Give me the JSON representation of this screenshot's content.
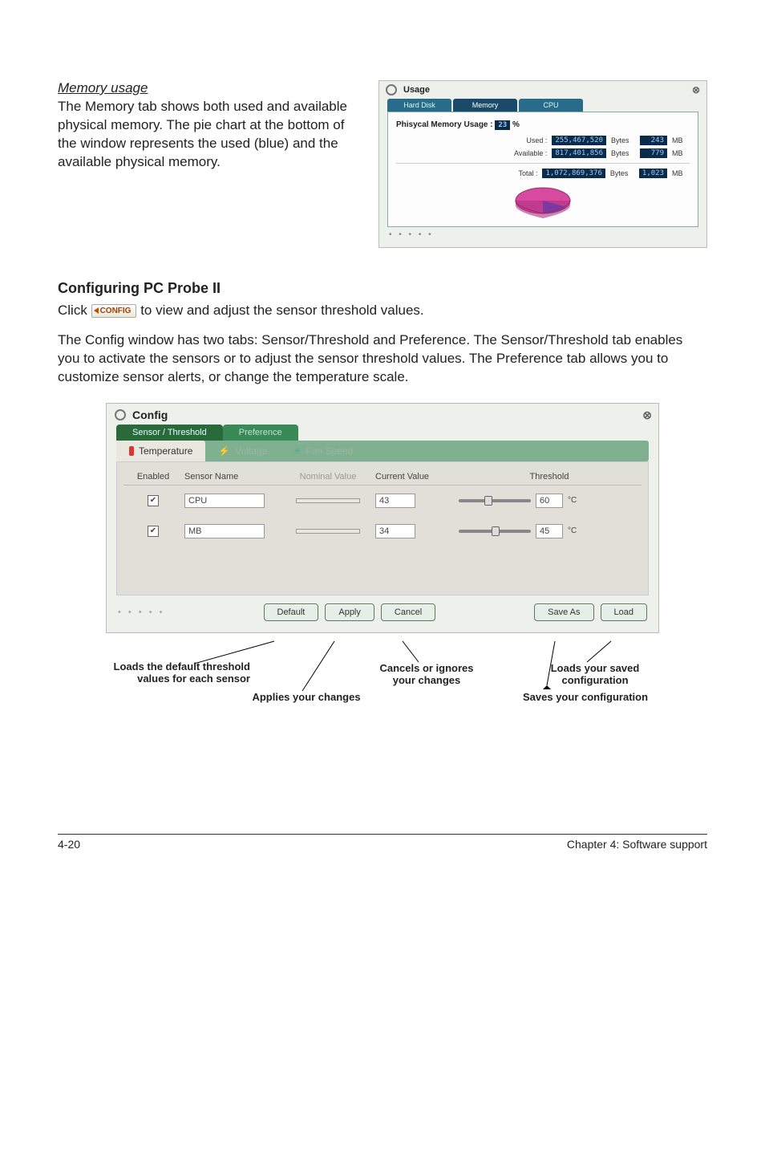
{
  "memorySection": {
    "title": "Memory usage",
    "body": "The Memory tab shows both used and available physical memory. The pie chart at the bottom of the window represents the used (blue) and the available physical memory."
  },
  "usageWindow": {
    "title": "Usage",
    "tabs": {
      "hd": "Hard Disk",
      "mem": "Memory",
      "cpu": "CPU"
    },
    "heading": "Phisycal Memory Usage :",
    "headingPct": "23",
    "headingPctUnit": "%",
    "rows": {
      "used": {
        "label": "Used :",
        "bytes": "255,467,520",
        "unit1": "Bytes",
        "mb": "243",
        "unit2": "MB"
      },
      "avail": {
        "label": "Available :",
        "bytes": "817,401,856",
        "unit1": "Bytes",
        "mb": "779",
        "unit2": "MB"
      },
      "total": {
        "label": "Total :",
        "bytes": "1,072,869,376",
        "unit1": "Bytes",
        "mb": "1,023",
        "unit2": "MB"
      }
    }
  },
  "configSection": {
    "heading": "Configuring PC Probe II",
    "line1a": "Click ",
    "configBtn": "CONFIG",
    "line1b": " to view and adjust the sensor threshold values.",
    "para2": "The Config window has two tabs: Sensor/Threshold and Preference. The Sensor/Threshold tab enables you to activate the sensors or to adjust the sensor threshold values. The Preference tab allows you to customize sensor alerts, or change the temperature scale."
  },
  "configWindow": {
    "title": "Config",
    "tabs1": {
      "sensor": "Sensor / Threshold",
      "pref": "Preference"
    },
    "tabs2": {
      "temp": "Temperature",
      "volt": "Voltage",
      "fan": "Fan Speed"
    },
    "headers": {
      "enabled": "Enabled",
      "name": "Sensor Name",
      "nominal": "Nominal Value",
      "current": "Current Value",
      "threshold": "Threshold"
    },
    "rows": [
      {
        "name": "CPU",
        "current": "43",
        "threshold": "60",
        "thumb": 35
      },
      {
        "name": "MB",
        "current": "34",
        "threshold": "45",
        "thumb": 45
      }
    ],
    "unit": "°C",
    "buttons": {
      "default": "Default",
      "apply": "Apply",
      "cancel": "Cancel",
      "saveas": "Save As",
      "load": "Load"
    }
  },
  "callouts": {
    "loadsDefault": "Loads the default threshold values for each sensor",
    "applies": "Applies your changes",
    "cancels": "Cancels or ignores your changes",
    "loadsSaved": "Loads your saved configuration",
    "saves": "Saves your configuration"
  },
  "footer": {
    "left": "4-20",
    "right": "Chapter 4: Software support"
  }
}
